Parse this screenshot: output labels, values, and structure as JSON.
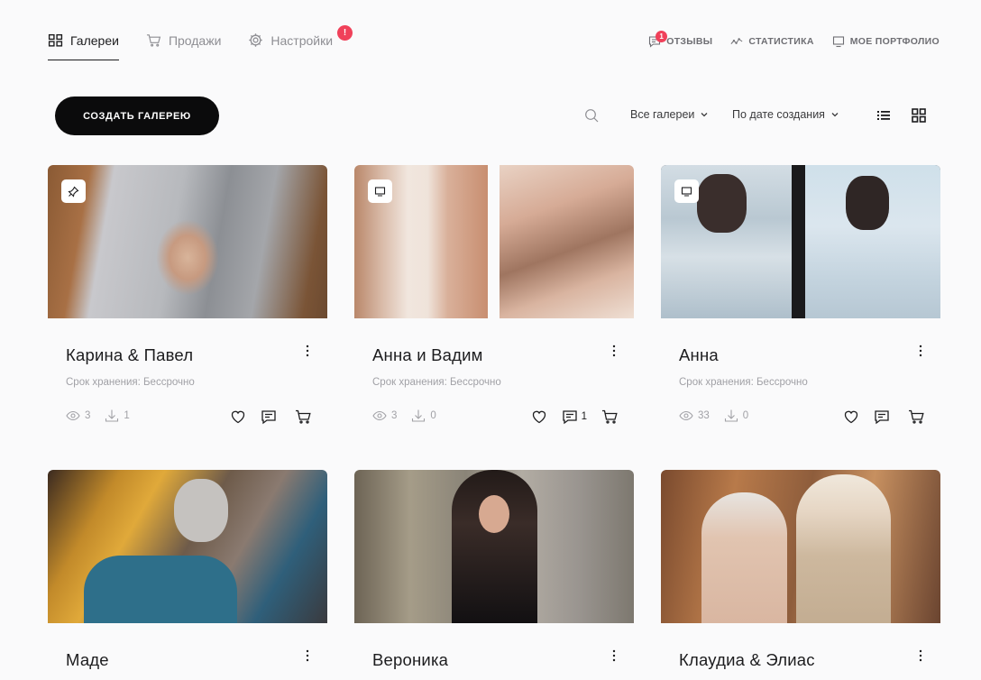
{
  "nav": {
    "tabs": [
      {
        "label": "Галереи",
        "icon": "grid-icon",
        "active": true
      },
      {
        "label": "Продажи",
        "icon": "cart-icon",
        "active": false
      },
      {
        "label": "Настройки",
        "icon": "gear-icon",
        "active": false,
        "badge": "!"
      }
    ],
    "links": [
      {
        "label": "ОТЗЫВЫ",
        "icon": "comment-icon",
        "badge": "1"
      },
      {
        "label": "СТАТИСТИКА",
        "icon": "chart-line-icon"
      },
      {
        "label": "МОЕ ПОРТФОЛИО",
        "icon": "monitor-icon"
      }
    ]
  },
  "toolbar": {
    "create_label": "СОЗДАТЬ ГАЛЕРЕЮ",
    "filter_label": "Все галереи",
    "sort_label": "По дате создания",
    "view_modes": [
      "list-view-icon",
      "grid-view-icon"
    ]
  },
  "galleries": [
    {
      "title": "Карина & Павел",
      "storage": "Срок хранения: Бессрочно",
      "views": "3",
      "downloads": "1",
      "comments": "",
      "badge_icon": "pin-icon"
    },
    {
      "title": "Анна и Вадим",
      "storage": "Срок хранения: Бессрочно",
      "views": "3",
      "downloads": "0",
      "comments": "1",
      "badge_icon": "monitor-icon"
    },
    {
      "title": "Анна",
      "storage": "Срок хранения: Бессрочно",
      "views": "33",
      "downloads": "0",
      "comments": "",
      "badge_icon": "monitor-icon"
    },
    {
      "title": "Маде",
      "storage": "",
      "views": "",
      "downloads": "",
      "comments": "",
      "badge_icon": ""
    },
    {
      "title": "Вероника",
      "storage": "",
      "views": "",
      "downloads": "",
      "comments": "",
      "badge_icon": ""
    },
    {
      "title": "Клаудиа & Элиас",
      "storage": "",
      "views": "",
      "downloads": "",
      "comments": "",
      "badge_icon": ""
    }
  ],
  "colors": {
    "accent_badge": "#f0415a",
    "primary_button": "#0b0b0c"
  }
}
